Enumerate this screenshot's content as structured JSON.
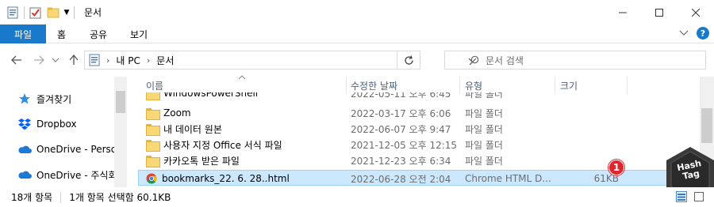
{
  "window": {
    "title": "문서"
  },
  "ribbon": {
    "tabs": [
      "파일",
      "홈",
      "공유",
      "보기"
    ]
  },
  "address": {
    "path": [
      "내 PC",
      "문서"
    ]
  },
  "search": {
    "placeholder": "문서 검색"
  },
  "navpane": {
    "items": [
      {
        "label": "즐겨찾기",
        "icon": "star-icon"
      },
      {
        "label": "Dropbox",
        "icon": "dropbox-icon"
      },
      {
        "label": "OneDrive - Person",
        "icon": "onedrive-icon"
      },
      {
        "label": "OneDrive - 주식회",
        "icon": "onedrive-icon"
      }
    ]
  },
  "filelist": {
    "columns": [
      "이름",
      "수정한 날짜",
      "유형",
      "크기"
    ],
    "partial_row": {
      "name": "WindowsPowerShell",
      "date": "2022-05-11 오후 6:45",
      "type": "파일 폴더"
    },
    "rows": [
      {
        "name": "Zoom",
        "date": "2022-03-17 오후 6:06",
        "type": "파일 폴더",
        "size": "",
        "icon": "folder-icon"
      },
      {
        "name": "내 데이터 원본",
        "date": "2022-06-07 오후 9:47",
        "type": "파일 폴더",
        "size": "",
        "icon": "folder-icon"
      },
      {
        "name": "사용자 지정 Office 서식 파일",
        "date": "2021-12-05 오후 12:15",
        "type": "파일 폴더",
        "size": "",
        "icon": "folder-icon"
      },
      {
        "name": "카카오톡 받은 파일",
        "date": "2021-12-23 오후 6:34",
        "type": "파일 폴더",
        "size": "",
        "icon": "folder-icon"
      },
      {
        "name": "bookmarks_22. 6. 28..html",
        "date": "2022-06-28 오전 2:04",
        "type": "Chrome HTML D...",
        "size": "61KB",
        "icon": "chrome-icon",
        "selected": true
      }
    ]
  },
  "annotation": {
    "badge": "1"
  },
  "watermark": {
    "line1": "Hash",
    "line2": "Tag"
  },
  "status": {
    "item_count": "18개 항목",
    "selection": "1개 항목 선택함 60.1KB"
  },
  "colors": {
    "accent": "#1979ca",
    "selection": "#cce8ff",
    "badge": "#e0252c"
  }
}
